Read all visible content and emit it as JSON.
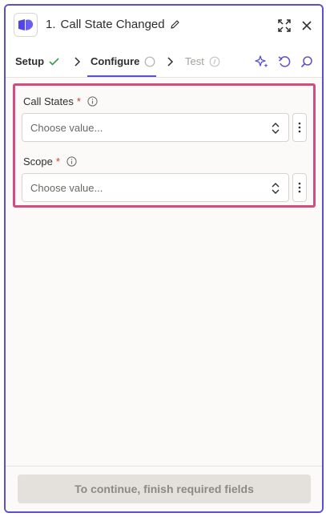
{
  "header": {
    "step_number": "1.",
    "title": "Call State Changed"
  },
  "steps": [
    {
      "label": "Setup",
      "status": "complete"
    },
    {
      "label": "Configure",
      "status": "active"
    },
    {
      "label": "Test",
      "status": "disabled"
    }
  ],
  "icons": {
    "app_logo": "dialpad-logo-icon",
    "edit": "pencil-icon",
    "expand": "expand-icon",
    "close": "close-icon",
    "step_separator": "chevron-right-icon",
    "ai": "sparkle-icon",
    "refresh": "undo-icon",
    "search": "search-icon"
  },
  "fields": [
    {
      "label": "Call States",
      "required_marker": "*",
      "placeholder": "Choose value..."
    },
    {
      "label": "Scope",
      "required_marker": "*",
      "placeholder": "Choose value..."
    }
  ],
  "footer": {
    "button_label": "To continue, finish required fields"
  },
  "colors": {
    "accent": "#5b4fcf",
    "highlight_border": "#d04d7d",
    "required": "#d0392b",
    "success": "#3a9a4a"
  }
}
